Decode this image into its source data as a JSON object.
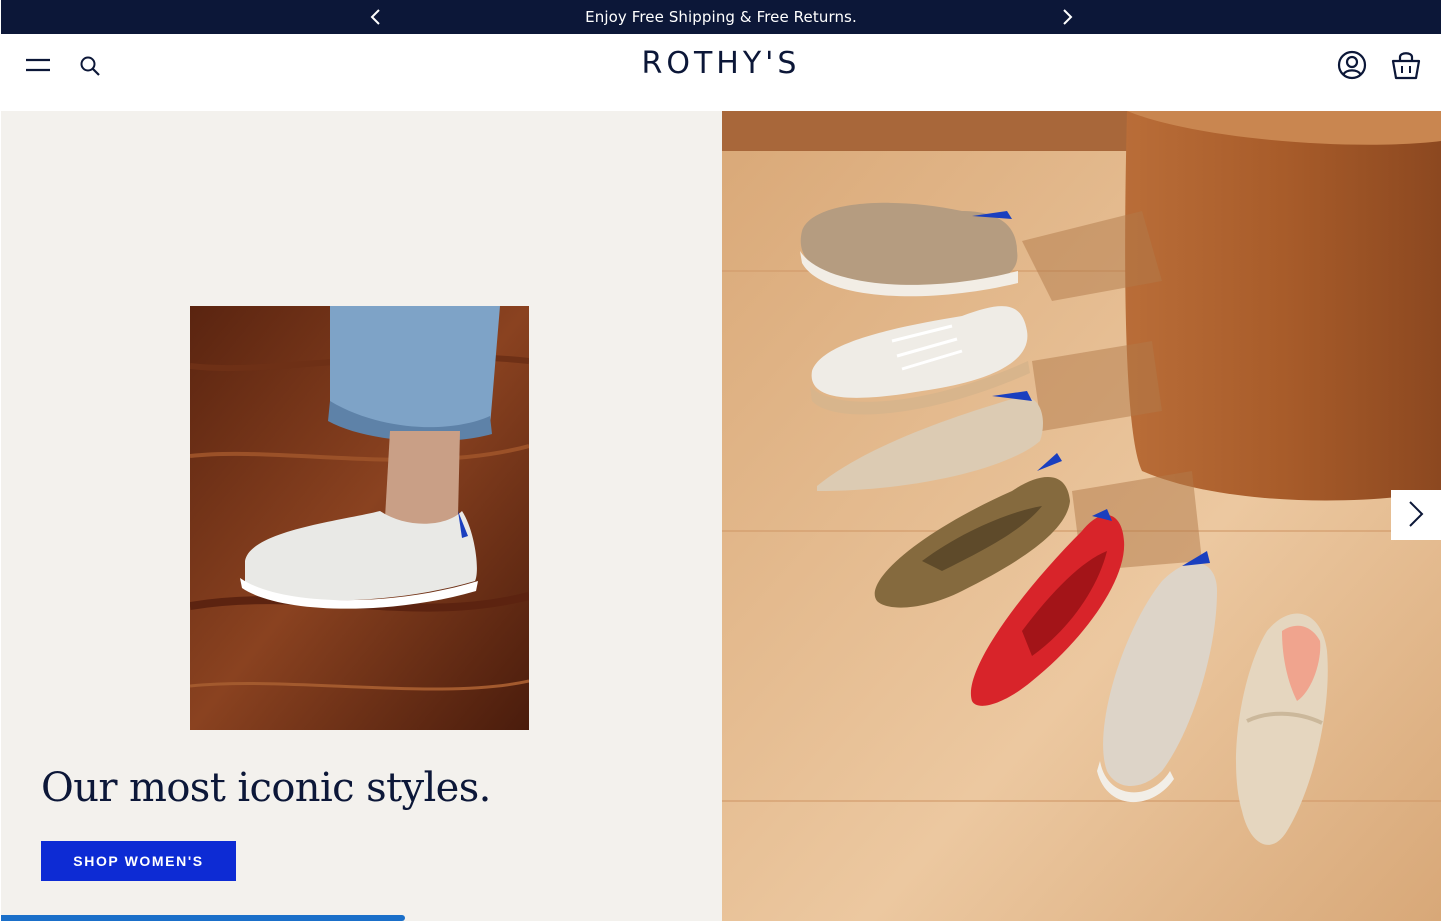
{
  "promo": {
    "message": "Enjoy Free Shipping & Free Returns.",
    "prev_icon": "chevron-left-icon",
    "next_icon": "chevron-right-icon"
  },
  "header": {
    "logo": "ROTHY'S",
    "icons": [
      "menu-icon",
      "search-icon",
      "account-icon",
      "shopping-bag-icon"
    ]
  },
  "hero": {
    "heading": "Our most iconic styles.",
    "cta_label": "SHOP WOMEN'S",
    "carousel_progress": 0.56,
    "next_icon": "chevron-right-icon",
    "colors": {
      "navy": "#0c1738",
      "cta_blue": "#0d2bd4",
      "progress_blue": "#1a6fc9",
      "panel_bg": "#f3f1ed"
    }
  }
}
